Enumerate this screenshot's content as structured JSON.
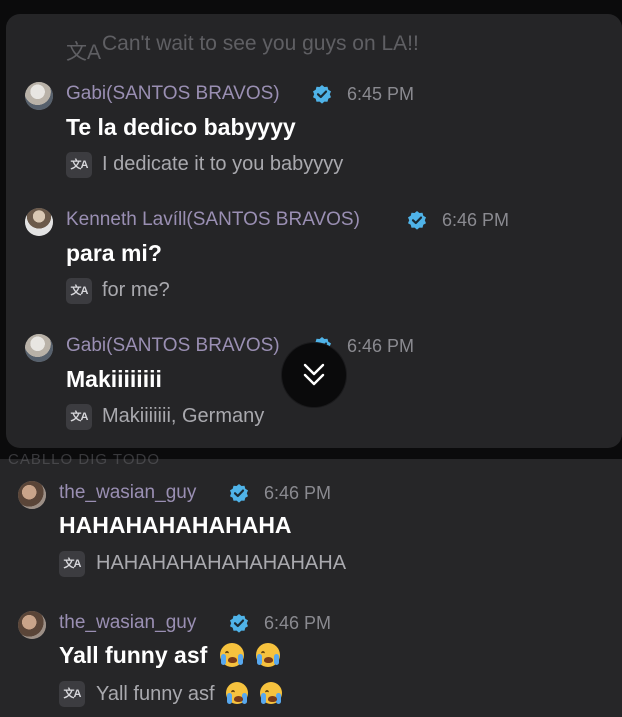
{
  "peek_top_text": "Can't wait to see you guys on LA!!",
  "peek_lower_text": "CABLLO DIG TODO",
  "translate_icon_glyph": "文A",
  "card_messages": [
    {
      "author": "Gabi(SANTOS BRAVOS)",
      "verified": true,
      "time": "6:45 PM",
      "body": "Te la dedico babyyyy",
      "translation": "I dedicate it to you babyyyy"
    },
    {
      "author": "Kenneth Lavíll(SANTOS BRAVOS)",
      "verified": true,
      "time": "6:46 PM",
      "body": "para mi?",
      "translation": "for me?"
    },
    {
      "author": "Gabi(SANTOS BRAVOS)",
      "verified": true,
      "time": "6:46 PM",
      "body": "Makiiiiiiii",
      "translation": "Makiiiiiii, Germany"
    }
  ],
  "lower_messages": [
    {
      "author": "the_wasian_guy",
      "verified": true,
      "time": "6:46 PM",
      "body": "HAHAHAHAHAHAHA",
      "translation": "HAHAHAHAHAHAHAHAHA"
    },
    {
      "author": "the_wasian_guy",
      "verified": true,
      "time": "6:46 PM",
      "body": "Yall funny asf",
      "translation": "Yall funny asf",
      "emoji": "loudly-crying-face"
    }
  ],
  "scroll_button_icon": "double-chevron-down-icon",
  "colors": {
    "verified_badge": "#4fb3e8",
    "author_name": "#9a8fb3",
    "card_bg": "#252527",
    "page_bg": "#0b0b0c"
  }
}
